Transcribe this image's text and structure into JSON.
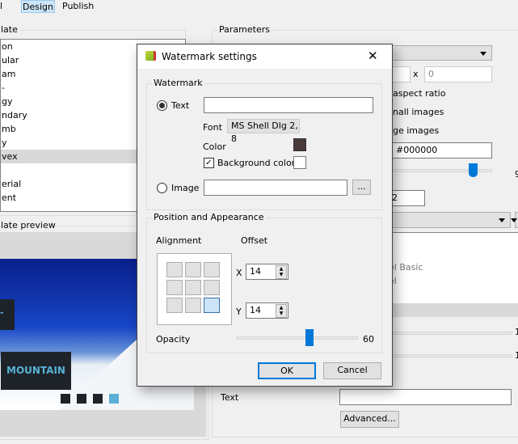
{
  "tabs": [
    {
      "label": "l"
    },
    {
      "label": "Design",
      "selected": true
    },
    {
      "label": "Publish"
    }
  ],
  "template_group": {
    "caption": "late",
    "items": [
      "on",
      "ular",
      "am",
      "-",
      "gy",
      "ndary",
      "mb",
      "y",
      "vex",
      "",
      "erial",
      "ent"
    ],
    "selected_index": 8
  },
  "preview_group": {
    "caption": "late preview",
    "banner_text": "MOUNTAIN",
    "banner_small": "-"
  },
  "parameters": {
    "caption": "Parameters",
    "size_x": "x",
    "size_height": "0",
    "aspect_ratio": "aspect ratio",
    "small_images": "nall images",
    "large_images": "ge images",
    "color_value": "#000000",
    "slider_label": "9",
    "number_value": "2",
    "list_items": [
      "el Basic",
      "el",
      "s"
    ],
    "slider1_label": "1",
    "slider2_label": "1",
    "text_label": "Text",
    "text_value": "",
    "advanced_button": "Advanced..."
  },
  "dialog": {
    "title": "Watermark settings",
    "icon": "app-icon",
    "close": "✕",
    "watermark_group": {
      "caption": "Watermark",
      "text_radio": "Text",
      "text_selected": true,
      "text_value": "",
      "font_label": "Font",
      "font_value": "MS Shell Dlg 2, 8",
      "color_label": "Color",
      "color": "#4a3a3a",
      "bg_color_label": "Background color",
      "bg_color_checked": true,
      "bg_color": "#ffffff",
      "image_radio": "Image",
      "image_value": "",
      "browse_button": "..."
    },
    "position_group": {
      "caption": "Position and Appearance",
      "alignment_label": "Alignment",
      "alignment_selected": "bottom-right",
      "offset_label": "Offset",
      "x_label": "X",
      "x_value": "14",
      "y_label": "Y",
      "y_value": "14",
      "opacity_label": "Opacity",
      "opacity_value": "60"
    },
    "ok_button": "OK",
    "cancel_button": "Cancel"
  },
  "colors": {
    "accent": "#0078d7",
    "selection": "#cce4f7"
  }
}
